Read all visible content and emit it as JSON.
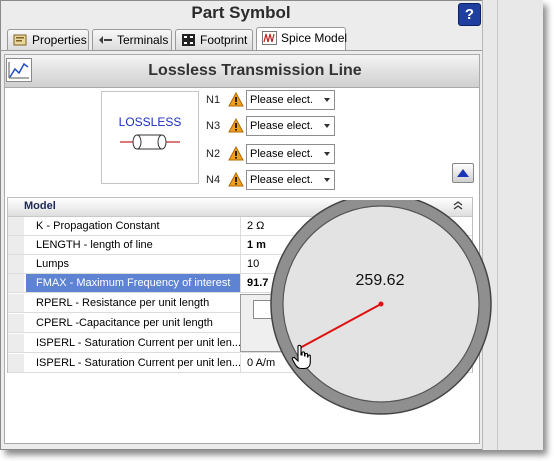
{
  "window": {
    "title": "Part Symbol",
    "help_icon": "?"
  },
  "tabs": [
    {
      "label": "Properties",
      "icon": "properties-icon"
    },
    {
      "label": "Terminals",
      "icon": "terminals-icon"
    },
    {
      "label": "Footprint",
      "icon": "footprint-icon"
    },
    {
      "label": "Spice Model",
      "icon": "spice-model-icon",
      "active": true
    }
  ],
  "header": {
    "title": "Lossless Transmission Line",
    "icon": "chart-icon"
  },
  "symbol": {
    "label": "LOSSLESS"
  },
  "pins": [
    {
      "label": "N1",
      "value": "Please elect."
    },
    {
      "label": "N3",
      "value": "Please elect."
    },
    {
      "label": "N2",
      "value": "Please elect."
    },
    {
      "label": "N4",
      "value": "Please elect."
    }
  ],
  "model": {
    "title": "Model",
    "rows": [
      {
        "name": "K - Propagation Constant",
        "value": "2  Ω"
      },
      {
        "name": "LENGTH - length of line",
        "value": "1  m"
      },
      {
        "name": "Lumps",
        "value": "10"
      },
      {
        "name": "FMAX - Maximum Frequency of interest",
        "value": "91.7"
      },
      {
        "name": "RPERL - Resistance per unit length",
        "value": ""
      },
      {
        "name": "CPERL -Capacitance per unit length",
        "value": ""
      },
      {
        "name": "ISPERL - Saturation Current per unit len...",
        "value": ""
      },
      {
        "name": "ISPERL - Saturation Current per unit len...",
        "value": "0 A/m"
      }
    ]
  },
  "dial": {
    "readout": "259.62",
    "level": 259.62
  },
  "colors": {
    "selection": "#5f83d3",
    "dial_needle": "#e01010",
    "symbol_text": "#1a2fc0",
    "warning": "#f0a020"
  }
}
